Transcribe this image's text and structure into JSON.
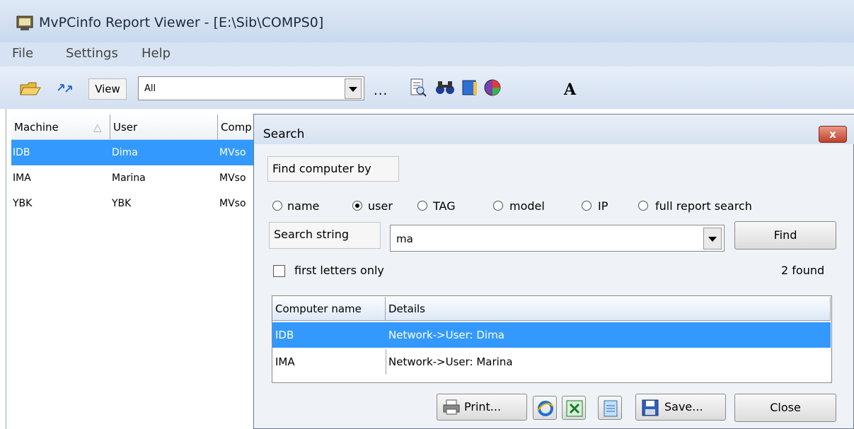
{
  "window": {
    "title": "MvPCinfo Report Viewer - [E:\\Sib\\COMPS0]"
  },
  "menu": [
    "File",
    "Settings",
    "Help"
  ],
  "toolbar": {
    "view_label": "View",
    "view_value": "All",
    "ellipsis": "...",
    "font_glyph": "A"
  },
  "grid": {
    "columns": [
      "Machine",
      "User",
      "Comp"
    ],
    "rows": [
      {
        "machine": "IDB",
        "user": "Dima",
        "comp": "MVso"
      },
      {
        "machine": "IMA",
        "user": "Marina",
        "comp": "MVso"
      },
      {
        "machine": "YBK",
        "user": "YBK",
        "comp": "MVso"
      }
    ]
  },
  "dialog": {
    "title": "Search",
    "close_glyph": "x",
    "find_by_label": "Find computer by",
    "options": [
      "name",
      "user",
      "TAG",
      "model",
      "IP",
      "full report search"
    ],
    "selected_option": "user",
    "search_label": "Search string",
    "search_value": "ma",
    "find_button": "Find",
    "first_letters_label": "first letters only",
    "found_count": "2 found",
    "results": {
      "columns": [
        "Computer name",
        "Details"
      ],
      "rows": [
        {
          "name": "IDB",
          "details": "Network->User: Dima"
        },
        {
          "name": "IMA",
          "details": "Network->User: Marina"
        }
      ]
    },
    "print_button": "Print...",
    "save_button": "Save...",
    "close_button": "Close"
  },
  "colors": {
    "selection": "#3399ff",
    "title_bar": "#d6e2f1"
  }
}
